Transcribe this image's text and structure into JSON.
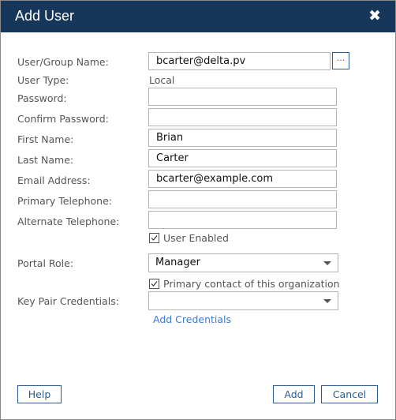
{
  "dialog": {
    "title": "Add User",
    "close_icon": "close-icon"
  },
  "form": {
    "user_group_name": {
      "label": "User/Group Name:",
      "value": "bcarter@delta.pv",
      "browse_label": "..."
    },
    "user_type": {
      "label": "User Type:",
      "value": "Local"
    },
    "password": {
      "label": "Password:",
      "value": ""
    },
    "confirm_password": {
      "label": "Confirm Password:",
      "value": ""
    },
    "first_name": {
      "label": "First Name:",
      "value": "Brian"
    },
    "last_name": {
      "label": "Last Name:",
      "value": "Carter"
    },
    "email": {
      "label": "Email Address:",
      "value": "bcarter@example.com"
    },
    "primary_telephone": {
      "label": "Primary Telephone:",
      "value": ""
    },
    "alternate_telephone": {
      "label": "Alternate Telephone:",
      "value": ""
    },
    "user_enabled": {
      "label": "User Enabled",
      "checked": true
    },
    "portal_role": {
      "label": "Portal Role:",
      "selected": "Manager"
    },
    "primary_contact": {
      "label": "Primary contact of this organization",
      "checked": true
    },
    "key_pair_credentials": {
      "label": "Key Pair Credentials:",
      "selected": ""
    },
    "add_credentials_link": "Add Credentials"
  },
  "footer": {
    "help_label": "Help",
    "add_label": "Add",
    "cancel_label": "Cancel"
  },
  "colors": {
    "titlebar": "#17375a",
    "accent": "#2a5d8f",
    "link": "#3a7bd5"
  }
}
